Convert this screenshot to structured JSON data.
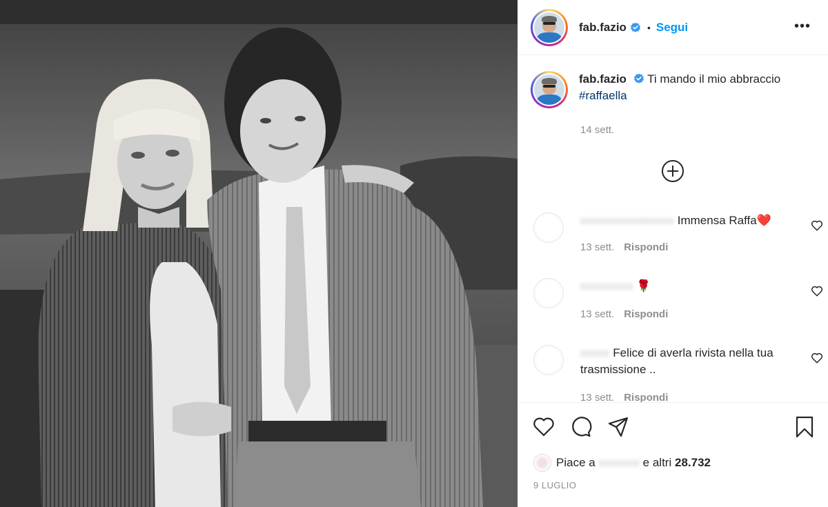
{
  "post": {
    "photo": {
      "alt": "",
      "kind": "black-and-white photo"
    },
    "header": {
      "username": "fab.fazio",
      "separator": "•",
      "follow_label": "Segui",
      "more_label": "•••"
    },
    "caption": {
      "username": "fab.fazio",
      "text": "Ti mando il mio abbraccio",
      "hashtag": "#raffaella",
      "time": "14 sett."
    },
    "comments": [
      {
        "author": "",
        "text": "Immensa Raffa❤️",
        "time": "13 sett.",
        "reply_label": "Rispondi"
      },
      {
        "author": "",
        "text": "🌹",
        "time": "13 sett.",
        "reply_label": "Rispondi"
      },
      {
        "author": "",
        "text": "Felice di averla rivista nella tua trasmissione ..",
        "time": "13 sett.",
        "reply_label": "Rispondi"
      }
    ],
    "likes": {
      "prefix": "Piace a",
      "hidden_user": "",
      "suffix": "e altri",
      "count": "28.732"
    },
    "date": "9 LUGLIO",
    "colors": {
      "accent": "#0095f6",
      "verified": "#3897f0",
      "hashtag": "#00376b",
      "muted": "#8e8e8e"
    },
    "icons": [
      "verified-icon",
      "more-icon",
      "add-comment-icon",
      "heart-icon",
      "comment-icon",
      "share-icon",
      "bookmark-icon"
    ]
  }
}
